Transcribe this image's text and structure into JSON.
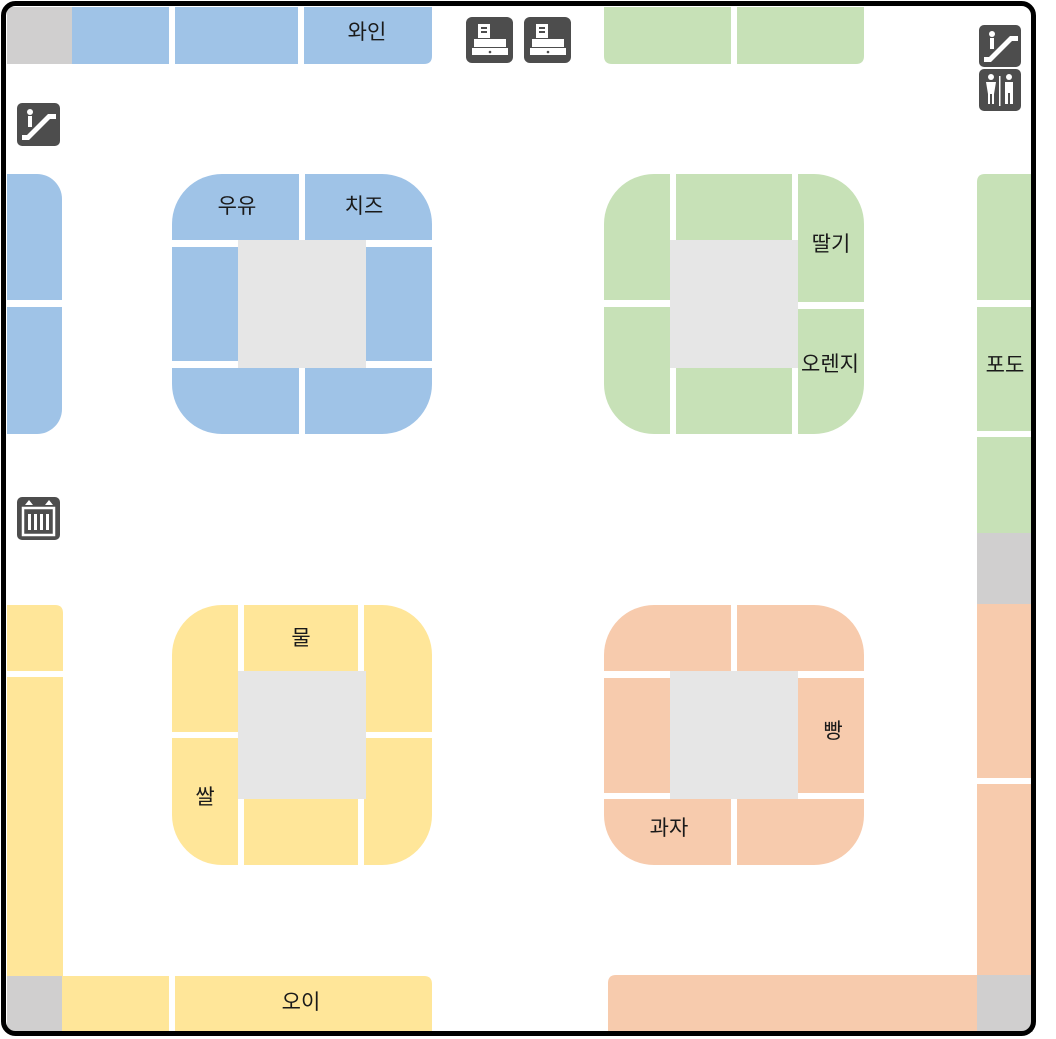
{
  "colors": {
    "blue": "#9fc3e7",
    "green": "#c7e1b7",
    "yellow": "#ffe699",
    "orange": "#f7cbad",
    "gray": "#d0cfcf",
    "center": "#e6e6e6",
    "icon_bg": "#4d4d4d",
    "frame": "#000000"
  },
  "labels": {
    "wine": "와인",
    "milk": "우유",
    "cheese": "치즈",
    "strawberry": "딸기",
    "orange": "오렌지",
    "grape": "포도",
    "water": "물",
    "rice": "쌀",
    "bread": "빵",
    "snack": "과자",
    "cucumber": "오이"
  },
  "icons": {
    "register": "cash-register-icon",
    "escalator": "escalator-icon",
    "restroom": "restroom-icon",
    "elevator": "elevator-icon"
  }
}
